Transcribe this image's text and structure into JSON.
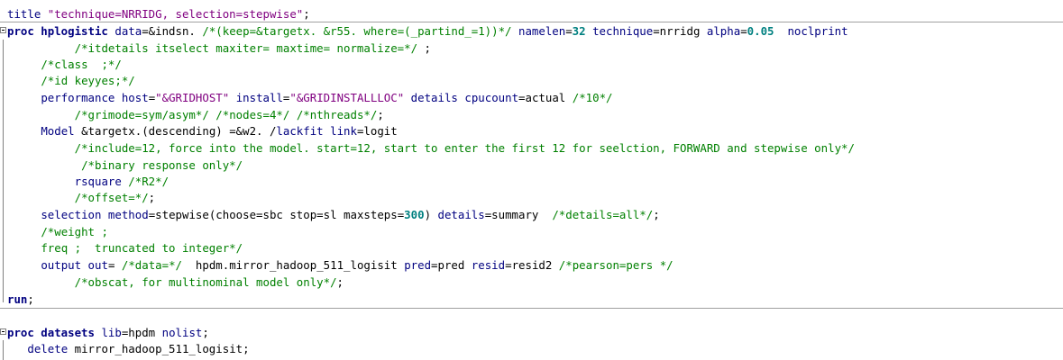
{
  "editor": {
    "lines": [
      {
        "indent": "",
        "fold": false,
        "tokens": [
          {
            "c": "kw",
            "t": "title "
          },
          {
            "c": "str",
            "t": "\"technique=NRRIDG, selection=stepwise\""
          },
          {
            "c": "txt",
            "t": ";"
          }
        ]
      },
      {
        "indent": "",
        "fold": true,
        "tokens": [
          {
            "c": "kwb",
            "t": "proc hplogistic"
          },
          {
            "c": "txt",
            "t": " "
          },
          {
            "c": "kw",
            "t": "data"
          },
          {
            "c": "txt",
            "t": "=&indsn. "
          },
          {
            "c": "cmt",
            "t": "/*(keep=&targetx. &r55. where=(_partind_=1))*/"
          },
          {
            "c": "txt",
            "t": " "
          },
          {
            "c": "kw",
            "t": "namelen"
          },
          {
            "c": "txt",
            "t": "="
          },
          {
            "c": "num",
            "t": "32"
          },
          {
            "c": "txt",
            "t": " "
          },
          {
            "c": "kw",
            "t": "technique"
          },
          {
            "c": "txt",
            "t": "=nrridg "
          },
          {
            "c": "kw",
            "t": "alpha"
          },
          {
            "c": "txt",
            "t": "="
          },
          {
            "c": "num",
            "t": "0.05"
          },
          {
            "c": "txt",
            "t": "  "
          },
          {
            "c": "kw",
            "t": "noclprint"
          }
        ]
      },
      {
        "indent": "          ",
        "fold": false,
        "tokens": [
          {
            "c": "cmt",
            "t": "/*itdetails itselect maxiter= maxtime= normalize=*/"
          },
          {
            "c": "txt",
            "t": " ;"
          }
        ]
      },
      {
        "indent": "     ",
        "fold": false,
        "tokens": [
          {
            "c": "cmt",
            "t": "/*class  ;*/"
          }
        ]
      },
      {
        "indent": "     ",
        "fold": false,
        "tokens": [
          {
            "c": "cmt",
            "t": "/*id keyyes;*/"
          }
        ]
      },
      {
        "indent": "     ",
        "fold": false,
        "tokens": [
          {
            "c": "kw",
            "t": "performance"
          },
          {
            "c": "txt",
            "t": " "
          },
          {
            "c": "kw",
            "t": "host"
          },
          {
            "c": "txt",
            "t": "="
          },
          {
            "c": "str",
            "t": "\"&GRIDHOST\""
          },
          {
            "c": "txt",
            "t": " "
          },
          {
            "c": "kw",
            "t": "install"
          },
          {
            "c": "txt",
            "t": "="
          },
          {
            "c": "str",
            "t": "\"&GRIDINSTALLLOC\""
          },
          {
            "c": "txt",
            "t": " "
          },
          {
            "c": "kw",
            "t": "details"
          },
          {
            "c": "txt",
            "t": " "
          },
          {
            "c": "kw",
            "t": "cpucount"
          },
          {
            "c": "txt",
            "t": "=actual "
          },
          {
            "c": "cmt",
            "t": "/*10*/"
          }
        ]
      },
      {
        "indent": "          ",
        "fold": false,
        "tokens": [
          {
            "c": "cmt",
            "t": "/*grimode=sym/asym*/"
          },
          {
            "c": "txt",
            "t": " "
          },
          {
            "c": "cmt",
            "t": "/*nodes=4*/"
          },
          {
            "c": "txt",
            "t": " "
          },
          {
            "c": "cmt",
            "t": "/*nthreads*/"
          },
          {
            "c": "txt",
            "t": ";"
          }
        ]
      },
      {
        "indent": "     ",
        "fold": false,
        "tokens": [
          {
            "c": "kw",
            "t": "Model"
          },
          {
            "c": "txt",
            "t": " &targetx.(descending) =&w2. /"
          },
          {
            "c": "kw",
            "t": "lackfit"
          },
          {
            "c": "txt",
            "t": " "
          },
          {
            "c": "kw",
            "t": "link"
          },
          {
            "c": "txt",
            "t": "=logit"
          }
        ]
      },
      {
        "indent": "          ",
        "fold": false,
        "tokens": [
          {
            "c": "cmt",
            "t": "/*include=12, force into the model. start=12, start to enter the first 12 for seelction, FORWARD and stepwise only*/"
          }
        ]
      },
      {
        "indent": "           ",
        "fold": false,
        "tokens": [
          {
            "c": "cmt",
            "t": "/*binary response only*/"
          }
        ]
      },
      {
        "indent": "          ",
        "fold": false,
        "tokens": [
          {
            "c": "kw",
            "t": "rsquare"
          },
          {
            "c": "txt",
            "t": " "
          },
          {
            "c": "cmt",
            "t": "/*R2*/"
          }
        ]
      },
      {
        "indent": "          ",
        "fold": false,
        "tokens": [
          {
            "c": "cmt",
            "t": "/*offset=*/"
          },
          {
            "c": "txt",
            "t": ";"
          }
        ]
      },
      {
        "indent": "     ",
        "fold": false,
        "tokens": [
          {
            "c": "kw",
            "t": "selection"
          },
          {
            "c": "txt",
            "t": " "
          },
          {
            "c": "kw",
            "t": "method"
          },
          {
            "c": "txt",
            "t": "=stepwise(choose=sbc stop=sl maxsteps="
          },
          {
            "c": "num",
            "t": "300"
          },
          {
            "c": "txt",
            "t": ") "
          },
          {
            "c": "kw",
            "t": "details"
          },
          {
            "c": "txt",
            "t": "=summary  "
          },
          {
            "c": "cmt",
            "t": "/*details=all*/"
          },
          {
            "c": "txt",
            "t": ";"
          }
        ]
      },
      {
        "indent": "     ",
        "fold": false,
        "tokens": [
          {
            "c": "cmt",
            "t": "/*weight ;"
          }
        ]
      },
      {
        "indent": "     ",
        "fold": false,
        "tokens": [
          {
            "c": "cmt",
            "t": "freq ;  truncated to integer*/"
          }
        ]
      },
      {
        "indent": "     ",
        "fold": false,
        "tokens": [
          {
            "c": "kw",
            "t": "output"
          },
          {
            "c": "txt",
            "t": " "
          },
          {
            "c": "kw",
            "t": "out"
          },
          {
            "c": "txt",
            "t": "= "
          },
          {
            "c": "cmt",
            "t": "/*data=*/"
          },
          {
            "c": "txt",
            "t": "  hpdm.mirror_hadoop_511_logisit "
          },
          {
            "c": "kw",
            "t": "pred"
          },
          {
            "c": "txt",
            "t": "=pred "
          },
          {
            "c": "kw",
            "t": "resid"
          },
          {
            "c": "txt",
            "t": "=resid2 "
          },
          {
            "c": "cmt",
            "t": "/*pearson=pers */"
          }
        ]
      },
      {
        "indent": "          ",
        "fold": false,
        "tokens": [
          {
            "c": "cmt",
            "t": "/*obscat, for multinominal model only*/"
          },
          {
            "c": "txt",
            "t": ";"
          }
        ]
      },
      {
        "indent": "",
        "fold": false,
        "tokens": [
          {
            "c": "kwb",
            "t": "run"
          },
          {
            "c": "txt",
            "t": ";"
          }
        ]
      },
      {
        "indent": "",
        "fold": false,
        "tokens": []
      },
      {
        "indent": "",
        "fold": true,
        "tokens": [
          {
            "c": "kwb",
            "t": "proc datasets"
          },
          {
            "c": "txt",
            "t": " "
          },
          {
            "c": "kw",
            "t": "lib"
          },
          {
            "c": "txt",
            "t": "=hpdm "
          },
          {
            "c": "kw",
            "t": "nolist"
          },
          {
            "c": "txt",
            "t": ";"
          }
        ]
      },
      {
        "indent": "   ",
        "fold": false,
        "tokens": [
          {
            "c": "kw",
            "t": "delete"
          },
          {
            "c": "txt",
            "t": " mirror_hadoop_511_logisit;"
          }
        ]
      }
    ]
  }
}
